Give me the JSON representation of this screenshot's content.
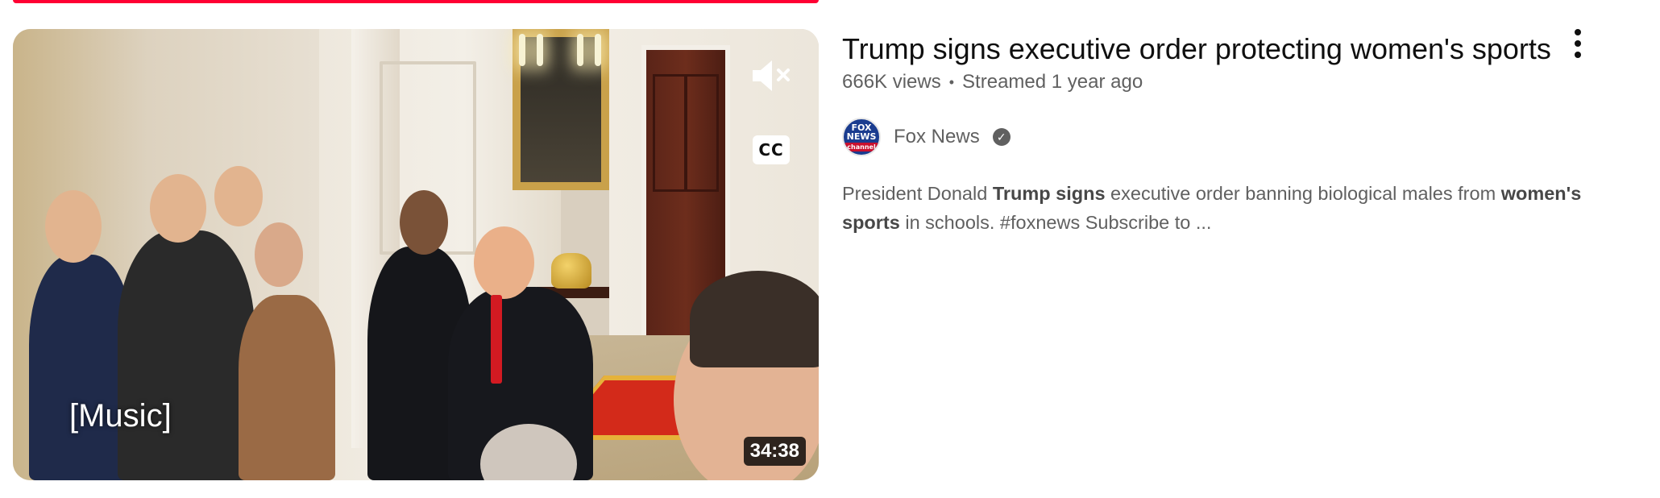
{
  "video": {
    "caption": "[Music]",
    "duration": "34:38",
    "cc_label": "CC"
  },
  "details": {
    "title": "Trump signs executive order protecting women's sports",
    "views": "666K views",
    "separator": "•",
    "streamed": "Streamed 1 year ago",
    "channel": {
      "name": "Fox News",
      "avatar_text_1": "FOX",
      "avatar_text_2": "NEWS",
      "avatar_text_3": "channel",
      "verified": true
    },
    "description": {
      "p1": "President Donald ",
      "b1": "Trump signs",
      "p2": " executive order banning biological males from ",
      "b2": "women's sports",
      "p3": " in schools. #foxnews Subscribe to ..."
    }
  },
  "icons": {
    "mute": "volume-muted-icon",
    "more": "more-vert-icon",
    "verified": "verified-check-icon"
  },
  "colors": {
    "progress_red": "#ff0033",
    "text_primary": "#0f0f0f",
    "text_secondary": "#606060"
  }
}
